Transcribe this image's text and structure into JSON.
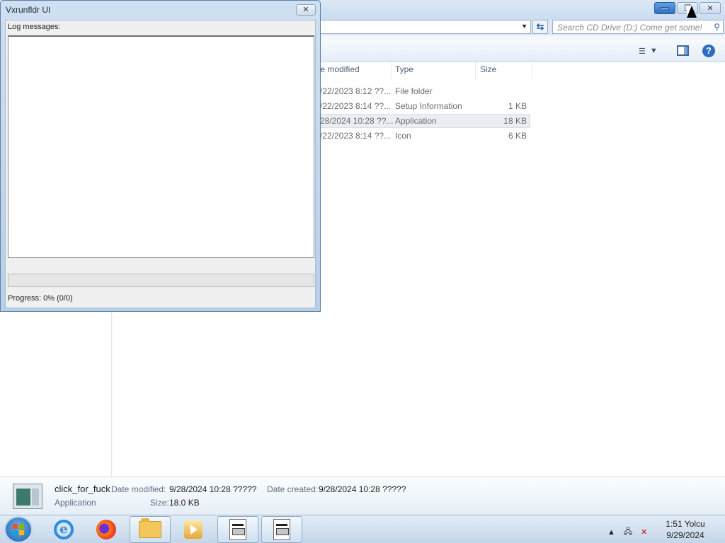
{
  "explorer": {
    "search_placeholder": "Search CD Drive (D:) Come get some!",
    "columns": [
      "te modified",
      "Type",
      "Size"
    ],
    "rows": [
      {
        "date": "/22/2023 8:12 ??...",
        "type": "File folder",
        "size": ""
      },
      {
        "date": "/22/2023 8:14 ??...",
        "type": "Setup Information",
        "size": "1 KB"
      },
      {
        "date": "28/2024 10:28 ??...",
        "type": "Application",
        "size": "18 KB"
      },
      {
        "date": "/22/2023 8:14 ??...",
        "type": "Icon",
        "size": "6 KB"
      }
    ],
    "selected_row": 2
  },
  "details": {
    "name": "click_for_fuck",
    "kind": "Application",
    "date_modified_label": "Date modified:",
    "date_modified": "9/28/2024 10:28 ?????",
    "date_created_label": "Date created:",
    "date_created": "9/28/2024 10:28 ?????",
    "size_label": "Size:",
    "size": "18.0 KB"
  },
  "dialog": {
    "title": "Vxrunfldr UI",
    "log_label": "Log messages:",
    "progress_text": "Progress: 0% (0/0)",
    "progress_fraction": 0
  },
  "taskbar": {
    "time": "1:51 Yolcu",
    "date": "9/29/2024",
    "items": [
      "start-orb",
      "internet-explorer",
      "firefox",
      "windows-explorer",
      "media-player",
      "app-window-1",
      "app-window-2"
    ]
  }
}
